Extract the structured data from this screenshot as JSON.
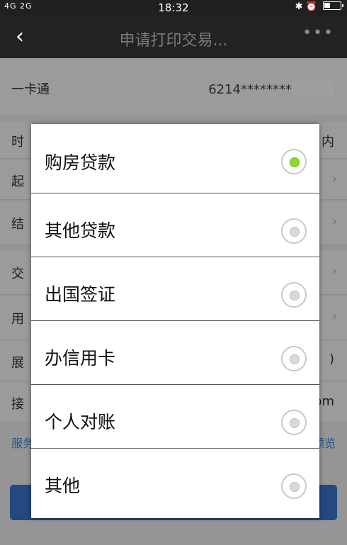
{
  "status": {
    "left": "4G 2G",
    "time": "18:32",
    "right": "✱ ⏰"
  },
  "nav": {
    "back": "‹",
    "title": "申请打印交易...",
    "more": "•••"
  },
  "rows": [
    {
      "label": "一卡通",
      "value": "6214********"
    },
    {
      "label": "时",
      "value": "内"
    },
    {
      "label": "起",
      "value": "›"
    },
    {
      "label": "结",
      "value": "›"
    },
    {
      "label": "交",
      "value": "›"
    },
    {
      "label": "用",
      "value": "›"
    },
    {
      "label": "展",
      "value": ")"
    },
    {
      "label": "接",
      "value": "om"
    }
  ],
  "footer": {
    "service_link": "服务",
    "preview_link": "预览"
  },
  "dialog": {
    "options": [
      {
        "label": "购房贷款",
        "selected": true
      },
      {
        "label": "其他贷款",
        "selected": false
      },
      {
        "label": "出国签证",
        "selected": false
      },
      {
        "label": "办信用卡",
        "selected": false
      },
      {
        "label": "个人对账",
        "selected": false
      },
      {
        "label": "其他",
        "selected": false
      }
    ]
  }
}
